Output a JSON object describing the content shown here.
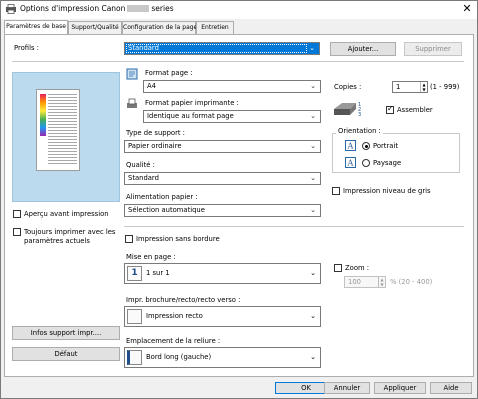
{
  "window": {
    "title_prefix": "Options d'impression Canon",
    "title_suffix": "series",
    "close_glyph": "✕"
  },
  "tabs": [
    {
      "label": "Paramètres de base",
      "active": true
    },
    {
      "label": "Support/Qualité",
      "active": false
    },
    {
      "label": "Configuration de la page",
      "active": false
    },
    {
      "label": "Entretien",
      "active": false
    }
  ],
  "profiles": {
    "label": "Profils :",
    "value": "Standard",
    "add_button": "Ajouter...",
    "delete_button": "Supprimer"
  },
  "left": {
    "preview_checkbox": "Aperçu avant impression",
    "always_print_line1": "Toujours imprimer avec les",
    "always_print_line2": "paramètres actuels",
    "media_info_button": "Infos support impr....",
    "default_button": "Défaut"
  },
  "page_size": {
    "label": "Format page :",
    "value": "A4"
  },
  "printer_paper_size": {
    "label": "Format papier imprimante :",
    "value": "Identique au format page"
  },
  "media_type": {
    "label": "Type de support :",
    "value": "Papier ordinaire"
  },
  "quality": {
    "label": "Qualité :",
    "value": "Standard"
  },
  "paper_source": {
    "label": "Alimentation papier :",
    "value": "Sélection automatique"
  },
  "copies": {
    "label": "Copies :",
    "value": "1",
    "range": "(1 - 999)",
    "collate_label": "Assembler"
  },
  "orientation": {
    "label": "Orientation :",
    "portrait": "Portrait",
    "landscape": "Paysage"
  },
  "grayscale": {
    "label": "Impression niveau de gris"
  },
  "borderless": {
    "label": "Impression sans bordure"
  },
  "page_layout": {
    "label": "Mise en page :",
    "value": "1 sur 1"
  },
  "zoom": {
    "label": "Zoom :",
    "value": "100",
    "range": "% (20 - 400)"
  },
  "duplex": {
    "label": "Impr. brochure/recto/recto verso :",
    "value": "Impression recto"
  },
  "stapling": {
    "label": "Emplacement de la reliure :",
    "value": "Bord long (gauche)"
  },
  "footer": {
    "ok": "OK",
    "cancel": "Annuler",
    "apply": "Appliquer",
    "help": "Aide"
  },
  "colors": {
    "accent": "#0078d7",
    "preview_bg": "#bcdaee"
  }
}
